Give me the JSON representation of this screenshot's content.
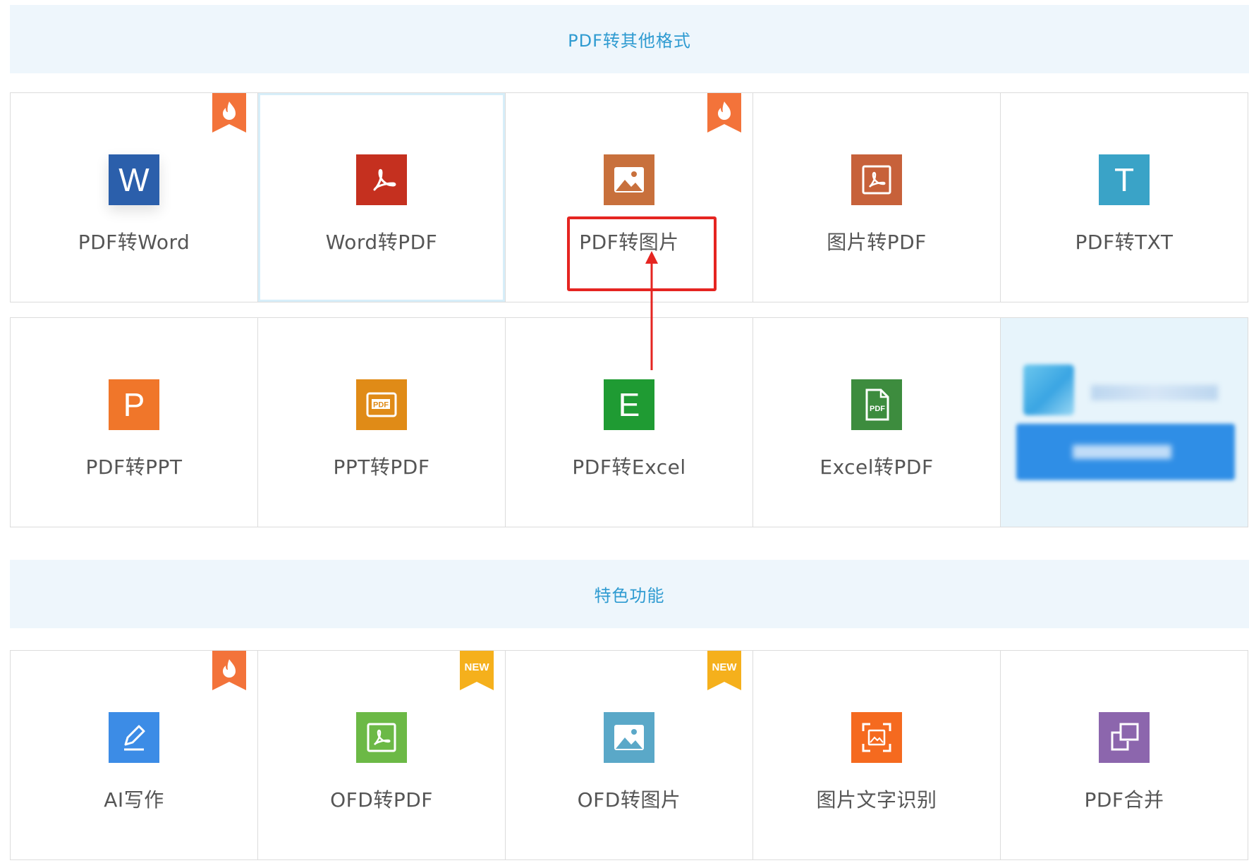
{
  "sections": [
    {
      "title": "PDF转其他格式",
      "tiles": [
        {
          "label": "PDF转Word",
          "icon": "word-icon",
          "color": "#2b5fab",
          "badge": "hot"
        },
        {
          "label": "Word转PDF",
          "icon": "acrobat-icon",
          "color": "#c5301f",
          "badge": null
        },
        {
          "label": "PDF转图片",
          "icon": "image-icon",
          "color": "#c8703c",
          "badge": "hot"
        },
        {
          "label": "图片转PDF",
          "icon": "acrobat-frame-icon",
          "color": "#c7613a",
          "badge": null
        },
        {
          "label": "PDF转TXT",
          "icon": "text-icon",
          "color": "#3aa3c7",
          "badge": null
        },
        {
          "label": "PDF转PPT",
          "icon": "powerpoint-icon",
          "color": "#f0762a",
          "badge": null
        },
        {
          "label": "PPT转PDF",
          "icon": "pdf-file-icon",
          "color": "#e08b17",
          "badge": null
        },
        {
          "label": "PDF转Excel",
          "icon": "excel-icon",
          "color": "#1f9b33",
          "badge": null
        },
        {
          "label": "Excel转PDF",
          "icon": "pdf-document-icon",
          "color": "#3d8c3e",
          "badge": null
        }
      ],
      "ad": {
        "blurred": true
      }
    },
    {
      "title": "特色功能",
      "tiles": [
        {
          "label": "AI写作",
          "icon": "pencil-icon",
          "color": "#3c8ce6",
          "badge": "hot"
        },
        {
          "label": "OFD转PDF",
          "icon": "acrobat-frame-icon",
          "color": "#6cb946",
          "badge": "new"
        },
        {
          "label": "OFD转图片",
          "icon": "image-icon",
          "color": "#5aa8c8",
          "badge": "new"
        },
        {
          "label": "图片文字识别",
          "icon": "scan-icon",
          "color": "#f56a1f",
          "badge": null
        },
        {
          "label": "PDF合并",
          "icon": "merge-icon",
          "color": "#8c66ad",
          "badge": null
        }
      ]
    }
  ],
  "badges": {
    "hot_color": "#f3733a",
    "new_color": "#f5b01c",
    "new_text": "NEW"
  },
  "ico_text": {
    "word": "W",
    "ppt": "P",
    "excel": "E",
    "txt": "T",
    "pdf": "PDF"
  },
  "annotation": {
    "color": "#e52521"
  }
}
